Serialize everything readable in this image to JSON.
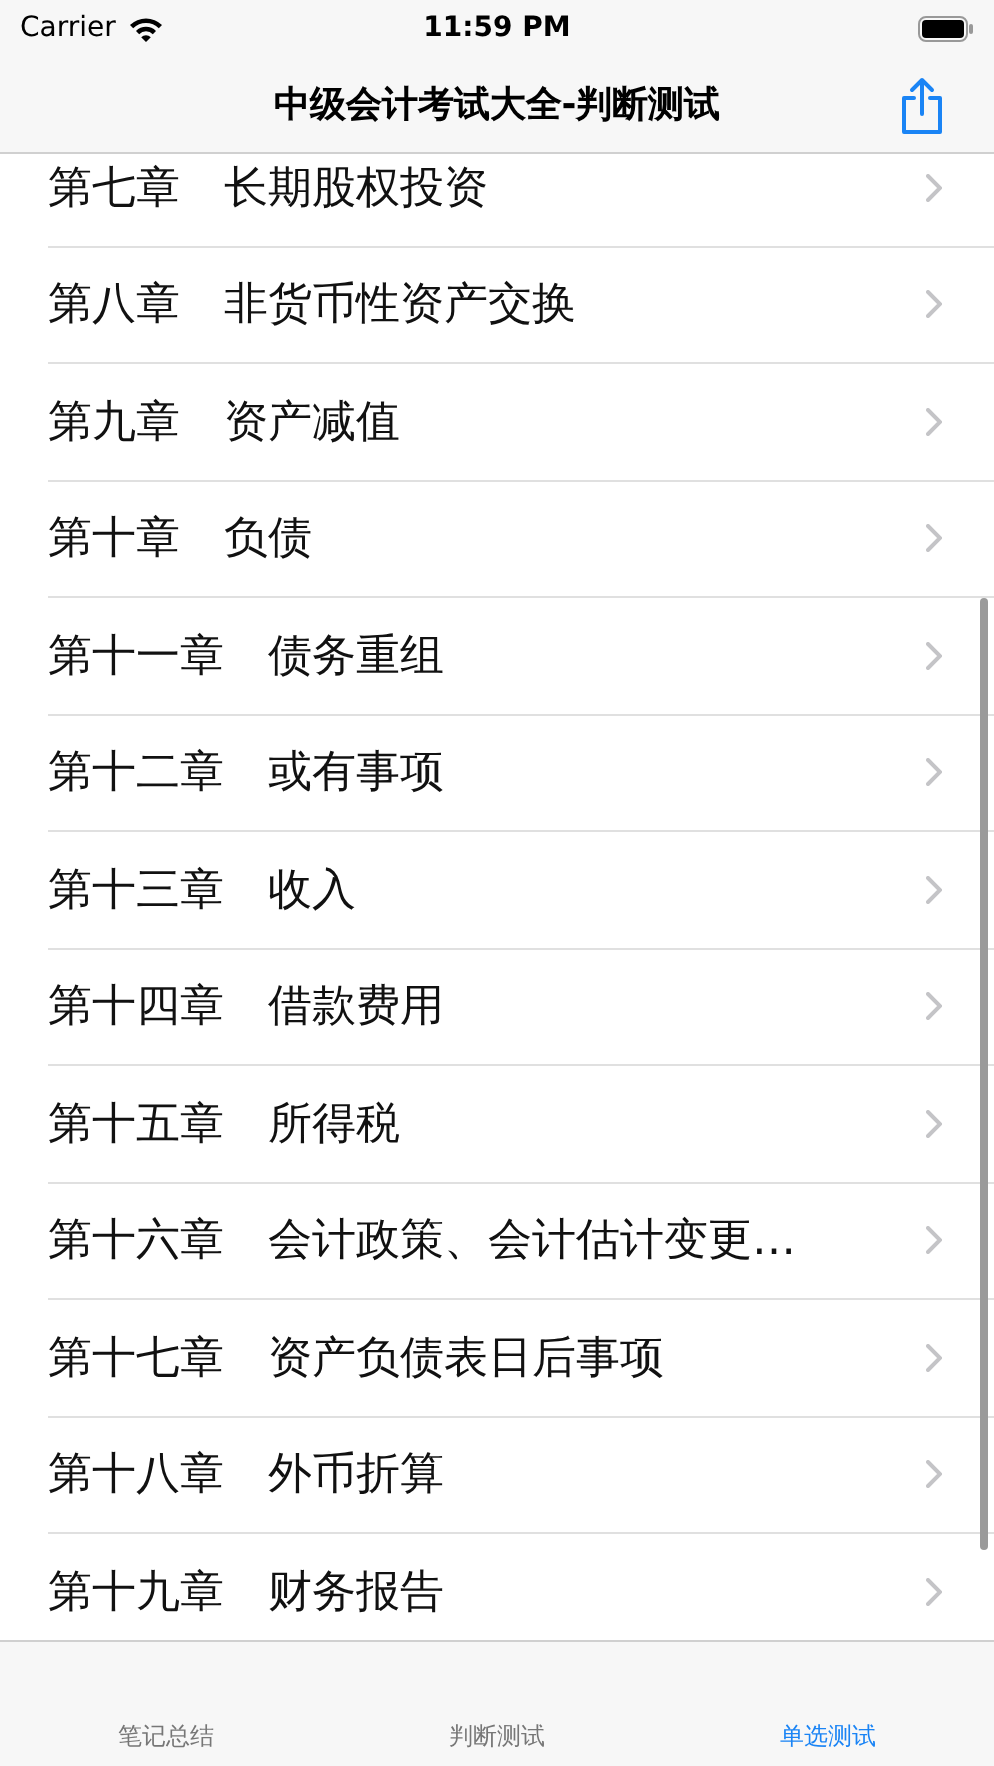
{
  "status_bar": {
    "carrier": "Carrier",
    "time": "11:59 PM"
  },
  "nav_bar": {
    "title": "中级会计考试大全-判断测试"
  },
  "chapters": [
    {
      "label": "第七章　长期股权投资"
    },
    {
      "label": "第八章　非货币性资产交换"
    },
    {
      "label": "第九章　资产减值"
    },
    {
      "label": "第十章　负债"
    },
    {
      "label": "第十一章　债务重组"
    },
    {
      "label": "第十二章　或有事项"
    },
    {
      "label": "第十三章　收入"
    },
    {
      "label": "第十四章　借款费用"
    },
    {
      "label": "第十五章　所得税"
    },
    {
      "label": "第十六章　会计政策、会计估计变更…"
    },
    {
      "label": "第十七章　资产负债表日后事项"
    },
    {
      "label": "第十八章　外币折算"
    },
    {
      "label": "第十九章　财务报告"
    }
  ],
  "tab_bar": [
    {
      "label": "笔记总结",
      "selected": false
    },
    {
      "label": "判断测试",
      "selected": false
    },
    {
      "label": "单选测试",
      "selected": true
    }
  ]
}
